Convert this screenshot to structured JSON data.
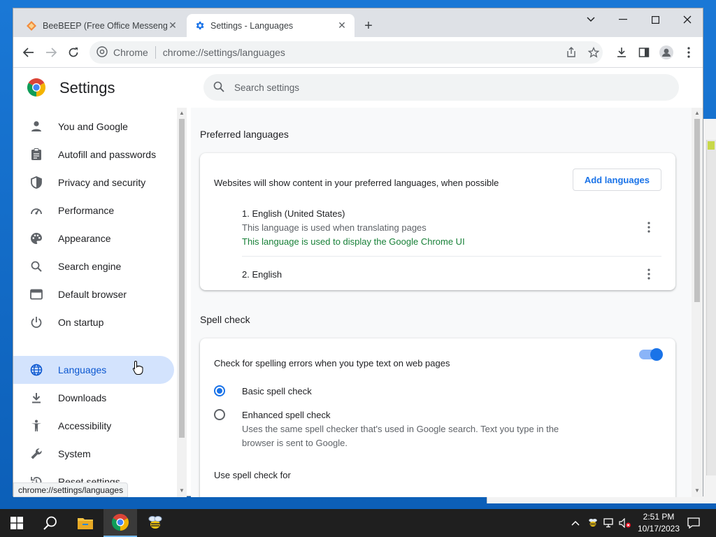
{
  "browser": {
    "tabs": [
      {
        "title": "BeeBEEP (Free Office Messenger)",
        "active": false
      },
      {
        "title": "Settings - Languages",
        "active": true
      }
    ],
    "omnibox": {
      "site_chip": "Chrome",
      "url": "chrome://settings/languages"
    },
    "status_url": "chrome://settings/languages"
  },
  "settings": {
    "title": "Settings",
    "search_placeholder": "Search settings",
    "nav": [
      {
        "label": "You and Google",
        "icon": "person-icon"
      },
      {
        "label": "Autofill and passwords",
        "icon": "clipboard-icon"
      },
      {
        "label": "Privacy and security",
        "icon": "shield-icon"
      },
      {
        "label": "Performance",
        "icon": "speedometer-icon"
      },
      {
        "label": "Appearance",
        "icon": "palette-icon"
      },
      {
        "label": "Search engine",
        "icon": "search-icon"
      },
      {
        "label": "Default browser",
        "icon": "browser-window-icon"
      },
      {
        "label": "On startup",
        "icon": "power-icon"
      },
      {
        "label": "Languages",
        "icon": "globe-icon",
        "selected": true
      },
      {
        "label": "Downloads",
        "icon": "download-icon"
      },
      {
        "label": "Accessibility",
        "icon": "accessibility-icon"
      },
      {
        "label": "System",
        "icon": "wrench-icon"
      },
      {
        "label": "Reset settings",
        "icon": "reset-icon"
      }
    ],
    "preferred_languages": {
      "title": "Preferred languages",
      "description": "Websites will show content in your preferred languages, when possible",
      "add_button": "Add languages",
      "languages": [
        {
          "name": "1. English (United States)",
          "note": "This language is used when translating pages",
          "ui_note": "This language is used to display the Google Chrome UI"
        },
        {
          "name": "2. English"
        }
      ]
    },
    "spell_check": {
      "title": "Spell check",
      "toggle_label": "Check for spelling errors when you type text on web pages",
      "toggle_on": true,
      "basic_label": "Basic spell check",
      "enhanced_label": "Enhanced spell check",
      "enhanced_desc_1": "Uses the same spell checker that's used in Google search. Text you type in the",
      "enhanced_desc_2": "browser is sent to Google.",
      "selected": "basic",
      "use_for_label": "Use spell check for"
    }
  },
  "taskbar": {
    "time": "2:51 PM",
    "date": "10/17/2023"
  },
  "colors": {
    "accent": "#1a73e8",
    "selected_bg": "#d3e3fd",
    "green_text": "#188038"
  }
}
